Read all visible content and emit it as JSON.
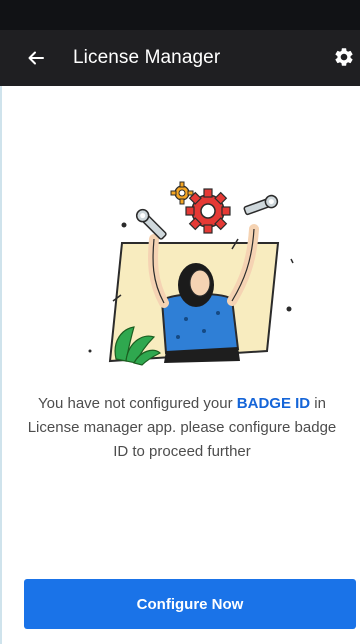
{
  "app_bar": {
    "title": "License Manager",
    "back_icon": "arrow-left-icon",
    "settings_icon": "gear-icon",
    "background": "#1f1f22"
  },
  "message": {
    "part1": "You have not configured your ",
    "highlight": "BADGE ID",
    "part2": " in License manager app. please configure badge ID to proceed further",
    "highlight_color": "#1565d8"
  },
  "illustration": {
    "icon": "person-with-wrenches-and-gears-illustration"
  },
  "actions": {
    "configure_label": "Configure Now",
    "accent": "#1a73e8"
  }
}
